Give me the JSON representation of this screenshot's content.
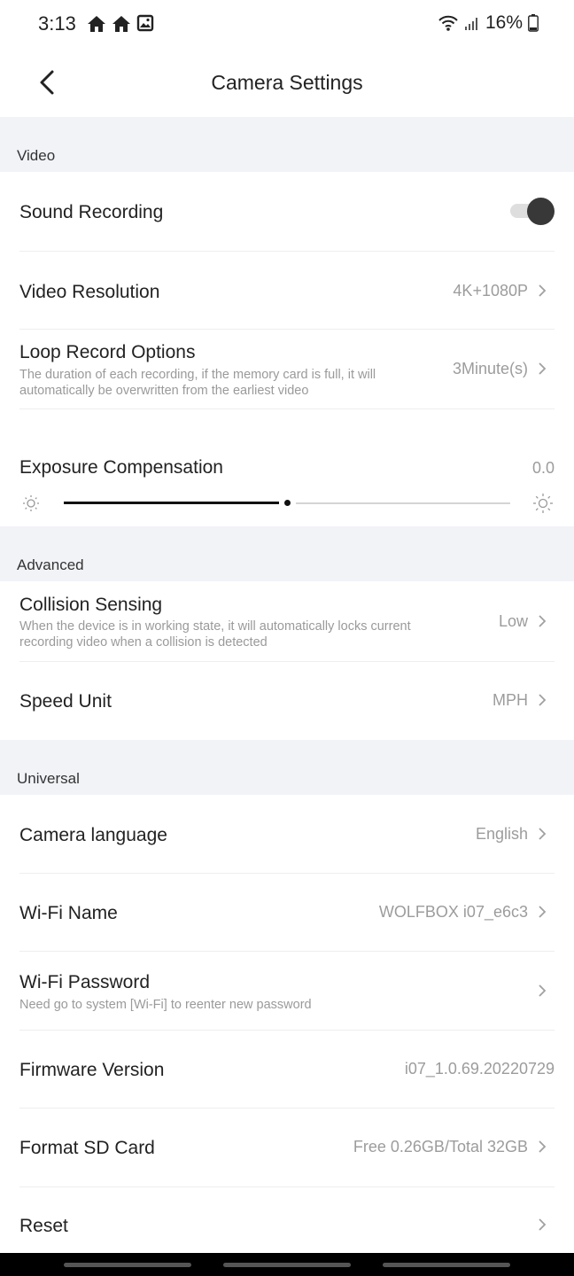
{
  "status_bar": {
    "time": "3:13",
    "battery": "16%",
    "left_icons": [
      "home-icon",
      "home-icon",
      "image-icon"
    ],
    "right_icons": [
      "wifi-icon",
      "signal-icon",
      "battery-icon"
    ]
  },
  "header": {
    "title": "Camera Settings",
    "back_icon": "chevron-left-icon"
  },
  "sections": {
    "video": {
      "label": "Video",
      "sound_recording": {
        "title": "Sound Recording",
        "enabled": true
      },
      "video_resolution": {
        "title": "Video Resolution",
        "value": "4K+1080P"
      },
      "loop_record": {
        "title": "Loop Record Options",
        "desc": "The duration of each recording, if the memory card is full, it will automatically be overwritten from the earliest video",
        "value": "3Minute(s)"
      },
      "exposure": {
        "title": "Exposure Compensation",
        "value": "0.0",
        "slider_level": 0.5
      }
    },
    "advanced": {
      "label": "Advanced",
      "collision": {
        "title": "Collision Sensing",
        "desc": "When the device is in working state, it will automatically locks current recording video when a collision is detected",
        "value": "Low"
      },
      "speed_unit": {
        "title": "Speed Unit",
        "value": "MPH"
      }
    },
    "universal": {
      "label": "Universal",
      "language": {
        "title": "Camera language",
        "value": "English"
      },
      "wifi_name": {
        "title": "Wi-Fi Name",
        "value": "WOLFBOX i07_e6c3"
      },
      "wifi_password": {
        "title": "Wi-Fi Password",
        "desc": "Need go to system [Wi-Fi] to reenter new password"
      },
      "firmware": {
        "title": "Firmware Version",
        "value": "i07_1.0.69.20220729"
      },
      "format_sd": {
        "title": "Format SD Card",
        "value": "Free 0.26GB/Total 32GB"
      },
      "reset": {
        "title": "Reset"
      }
    }
  },
  "colors": {
    "section_bg": "#f1f3f7",
    "accent_dark": "#383838",
    "muted_text": "#9c9c9c"
  }
}
